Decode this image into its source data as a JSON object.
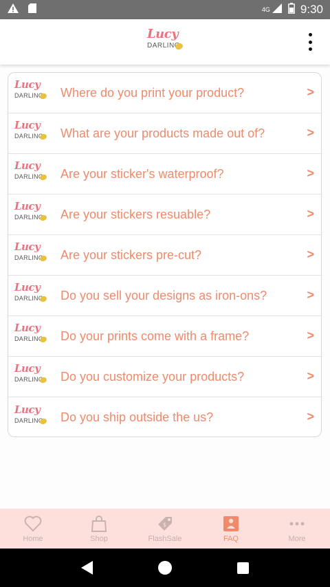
{
  "status_bar": {
    "time": "9:30",
    "network": "4G",
    "icons": [
      "warning-icon",
      "sd-card-icon",
      "signal-icon",
      "battery-icon"
    ]
  },
  "app_bar": {
    "logo_script": "Lucy",
    "logo_sub": "DARLING",
    "menu_icon": "overflow-menu-icon"
  },
  "faq": {
    "items": [
      {
        "question": "Where do you print your product?",
        "chevron": ">"
      },
      {
        "question": "What are your products made out of?",
        "chevron": ">"
      },
      {
        "question": "Are your sticker's waterproof?",
        "chevron": ">"
      },
      {
        "question": "Are your stickers resuable?",
        "chevron": ">"
      },
      {
        "question": "Are your stickers pre-cut?",
        "chevron": ">"
      },
      {
        "question": "Do you sell your designs as iron-ons?",
        "chevron": ">"
      },
      {
        "question": "Do your prints come with a frame?",
        "chevron": ">"
      },
      {
        "question": "Do you customize your products?",
        "chevron": ">"
      },
      {
        "question": "Do you ship outside the us?",
        "chevron": ">"
      }
    ],
    "row_logo_script": "Lucy",
    "row_logo_sub": "DARLING"
  },
  "tab_bar": {
    "tabs": [
      {
        "label": "Home",
        "icon": "heart-icon",
        "active": false
      },
      {
        "label": "Shop",
        "icon": "shopping-bag-icon",
        "active": false
      },
      {
        "label": "FlashSale",
        "icon": "price-tag-icon",
        "active": false
      },
      {
        "label": "FAQ",
        "icon": "faq-icon",
        "active": true
      },
      {
        "label": "More",
        "icon": "more-dots-icon",
        "active": false
      }
    ]
  },
  "colors": {
    "accent": "#ef8a6b",
    "tab_bar_bg": "#fde0db",
    "status_bar_bg": "#6f6f6f",
    "logo_pink": "#e97380",
    "logo_yellow": "#e9c23f"
  }
}
